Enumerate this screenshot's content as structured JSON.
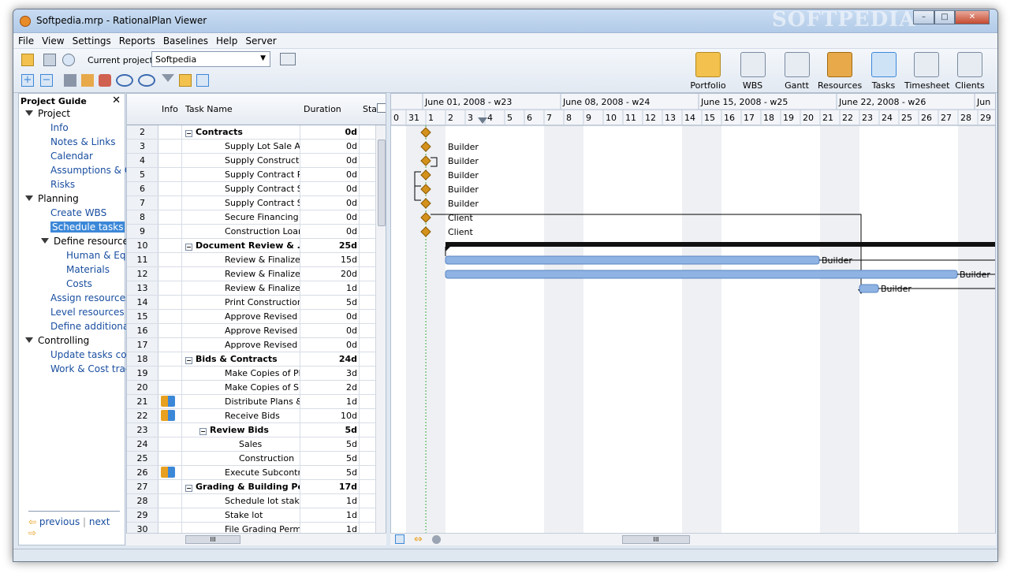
{
  "window": {
    "title": "Softpedia.mrp - RationalPlan Viewer",
    "watermark": "SOFTPEDIA",
    "controls": {
      "minimize": "–",
      "maximize": "□",
      "close": "✕"
    }
  },
  "menu": [
    "File",
    "View",
    "Settings",
    "Reports",
    "Baselines",
    "Help",
    "Server"
  ],
  "toolbar": {
    "current_project_label": "Current project:",
    "current_project_value": "Softpedia",
    "views": [
      {
        "label": "Portfolio",
        "icon": "portfolio-folder-icon",
        "color": "#f2c14e"
      },
      {
        "label": "WBS",
        "icon": "wbs-icon",
        "color": "#e7ecf3"
      },
      {
        "label": "Gantt",
        "icon": "gantt-icon",
        "color": "#e7ecf3"
      },
      {
        "label": "Resources",
        "icon": "resources-people-icon",
        "color": "#e8a94a"
      },
      {
        "label": "Tasks",
        "icon": "tasks-clipboard-icon",
        "color": "#cfe3f7"
      },
      {
        "label": "Timesheet",
        "icon": "timesheet-calendar-icon",
        "color": "#e7ecf3"
      },
      {
        "label": "Clients",
        "icon": "clients-book-icon",
        "color": "#e7ecf3"
      }
    ]
  },
  "guide": {
    "title": "Project Guide",
    "close": "✕",
    "items": [
      {
        "label": "Project",
        "type": "section"
      },
      {
        "label": "Info",
        "type": "link"
      },
      {
        "label": "Notes & Links",
        "type": "link"
      },
      {
        "label": "Calendar",
        "type": "link"
      },
      {
        "label": "Assumptions & Cor",
        "type": "link"
      },
      {
        "label": "Risks",
        "type": "link"
      },
      {
        "label": "Planning",
        "type": "section"
      },
      {
        "label": "Create WBS",
        "type": "link"
      },
      {
        "label": "Schedule tasks",
        "type": "selected"
      },
      {
        "label": "Define resources",
        "type": "subsection"
      },
      {
        "label": "Human & Equip",
        "type": "sublink"
      },
      {
        "label": "Materials",
        "type": "sublink"
      },
      {
        "label": "Costs",
        "type": "sublink"
      },
      {
        "label": "Assign resources",
        "type": "link"
      },
      {
        "label": "Level resources",
        "type": "link"
      },
      {
        "label": "Define additional co",
        "type": "link"
      },
      {
        "label": "Controlling",
        "type": "section"
      },
      {
        "label": "Update tasks comp",
        "type": "link"
      },
      {
        "label": "Work & Cost trackin",
        "type": "link"
      }
    ],
    "previous": "previous",
    "next": "next"
  },
  "grid": {
    "columns": {
      "info": "Info",
      "task_name": "Task Name",
      "duration": "Duration",
      "start": "Sta"
    },
    "rows": [
      {
        "id": "2",
        "name": "Contracts",
        "dur": "0d",
        "level": 0,
        "summary": true
      },
      {
        "id": "3",
        "name": "Supply Lot Sale Agre...",
        "dur": "0d",
        "level": 1
      },
      {
        "id": "4",
        "name": "Supply Construction ...",
        "dur": "0d",
        "level": 1
      },
      {
        "id": "5",
        "name": "Supply Contract Plan...",
        "dur": "0d",
        "level": 1
      },
      {
        "id": "6",
        "name": "Supply Contract Spe...",
        "dur": "0d",
        "level": 1
      },
      {
        "id": "7",
        "name": "Supply Contract Site...",
        "dur": "0d",
        "level": 1
      },
      {
        "id": "8",
        "name": "Secure Financing",
        "dur": "0d",
        "level": 1
      },
      {
        "id": "9",
        "name": "Construction Loan S...",
        "dur": "0d",
        "level": 1
      },
      {
        "id": "10",
        "name": "Document Review & ...",
        "dur": "25d",
        "level": 0,
        "summary": true
      },
      {
        "id": "11",
        "name": "Review & Finalize Pla...",
        "dur": "15d",
        "level": 1
      },
      {
        "id": "12",
        "name": "Review & Finalize Sp...",
        "dur": "20d",
        "level": 1
      },
      {
        "id": "13",
        "name": "Review & Finalize Sit...",
        "dur": "1d",
        "level": 1
      },
      {
        "id": "14",
        "name": "Print Construction Dr...",
        "dur": "5d",
        "level": 1
      },
      {
        "id": "15",
        "name": "Approve Revised Pla...",
        "dur": "0d",
        "level": 1
      },
      {
        "id": "16",
        "name": "Approve Revised Sp...",
        "dur": "0d",
        "level": 1
      },
      {
        "id": "17",
        "name": "Approve Revised Sit...",
        "dur": "0d",
        "level": 1
      },
      {
        "id": "18",
        "name": "Bids & Contracts",
        "dur": "24d",
        "level": 0,
        "summary": true
      },
      {
        "id": "19",
        "name": "Make Copies of Plan...",
        "dur": "3d",
        "level": 1
      },
      {
        "id": "20",
        "name": "Make Copies of Spec...",
        "dur": "2d",
        "level": 1
      },
      {
        "id": "21",
        "name": "Distribute Plans & Sp...",
        "dur": "1d",
        "level": 1,
        "info": true
      },
      {
        "id": "22",
        "name": "Receive Bids",
        "dur": "10d",
        "level": 1,
        "info": true
      },
      {
        "id": "23",
        "name": "Review Bids",
        "dur": "5d",
        "level": 1,
        "summary": true
      },
      {
        "id": "24",
        "name": "Sales",
        "dur": "5d",
        "level": 2
      },
      {
        "id": "25",
        "name": "Construction",
        "dur": "5d",
        "level": 2
      },
      {
        "id": "26",
        "name": "Execute Subcontract...",
        "dur": "5d",
        "level": 1,
        "info": true
      },
      {
        "id": "27",
        "name": "Grading & Building Pe...",
        "dur": "17d",
        "level": 0,
        "summary": true
      },
      {
        "id": "28",
        "name": "Schedule lot stake-o...",
        "dur": "1d",
        "level": 1
      },
      {
        "id": "29",
        "name": "Stake lot",
        "dur": "1d",
        "level": 1
      },
      {
        "id": "30",
        "name": "File Grading Permit A...",
        "dur": "1d",
        "level": 1
      }
    ]
  },
  "gantt": {
    "weeks": [
      "June 01, 2008 - w23",
      "June 08, 2008 - w24",
      "June 15, 2008 - w25",
      "June 22, 2008 - w26",
      "Jun"
    ],
    "days": [
      "0",
      "31",
      "1",
      "2",
      "3",
      "4",
      "5",
      "6",
      "7",
      "8",
      "9",
      "10",
      "11",
      "12",
      "13",
      "14",
      "15",
      "16",
      "17",
      "18",
      "19",
      "20",
      "21",
      "22",
      "23",
      "24",
      "25",
      "26",
      "27",
      "28",
      "29"
    ],
    "milestone_color": "#d4921c",
    "bar_color": "#8fb3e3",
    "weekend_color": "#eef0f3",
    "labels": [
      "Builder",
      "Builder",
      "Builder",
      "Builder",
      "Builder",
      "Client",
      "Client",
      "Builder",
      "Builder",
      "Builder"
    ]
  },
  "scroll": {
    "thumb": "III"
  }
}
